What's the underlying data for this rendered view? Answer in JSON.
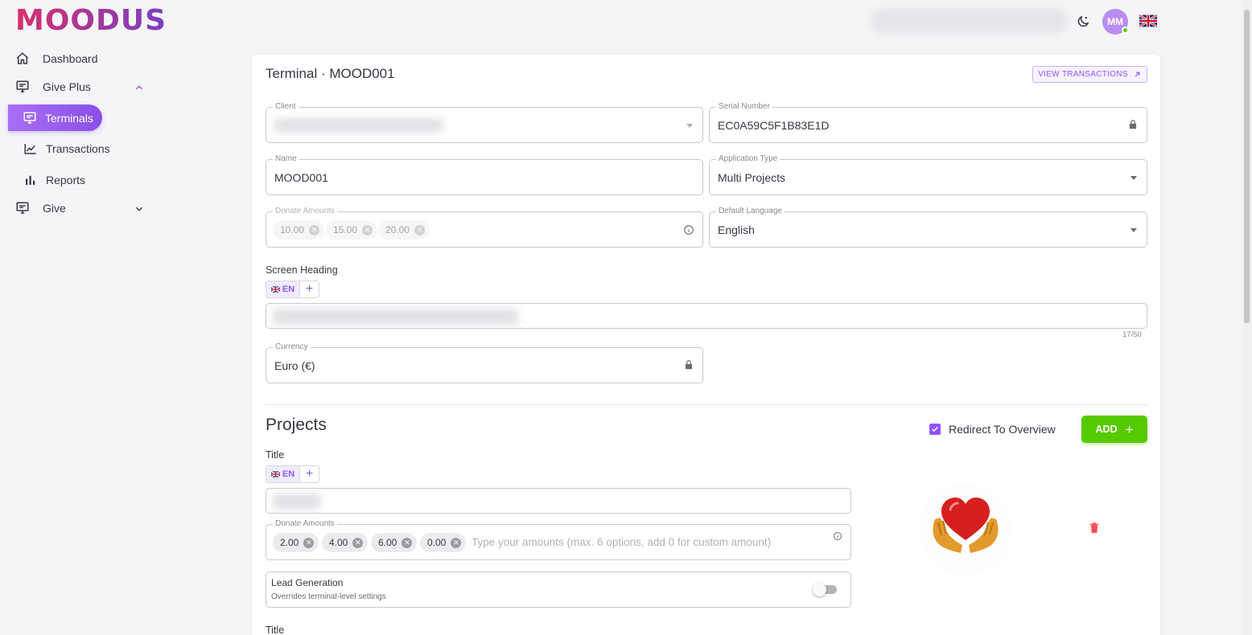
{
  "brand": {
    "logo_text": "MOODUS",
    "gradient_start": "#d8316a",
    "gradient_end": "#7b3fc4"
  },
  "topbar": {
    "theme_icon": "moon-icon",
    "avatar_initials": "MM",
    "language_flag": "uk-flag-icon"
  },
  "sidebar": {
    "items": [
      {
        "label": "Dashboard",
        "icon": "home-icon"
      },
      {
        "label": "Give Plus",
        "icon": "terminal-icon",
        "expanded": true
      },
      {
        "label": "Terminals",
        "icon": "terminal-icon",
        "active": true
      },
      {
        "label": "Transactions",
        "icon": "chart-line-icon"
      },
      {
        "label": "Reports",
        "icon": "bar-chart-icon"
      },
      {
        "label": "Give",
        "icon": "terminal-icon",
        "expanded": false
      }
    ]
  },
  "page": {
    "title": "Terminal · MOOD001",
    "view_transactions": "VIEW TRANSACTIONS"
  },
  "form": {
    "client": {
      "label": "Client"
    },
    "serial_number": {
      "label": "Serial Number",
      "value": "EC0A59C5F1B83E1D",
      "locked": true
    },
    "name": {
      "label": "Name",
      "value": "MOOD001"
    },
    "application_type": {
      "label": "Application Type",
      "value": "Multi Projects"
    },
    "donate_amounts": {
      "label": "Donate Amounts",
      "chips": [
        "10.00",
        "15.00",
        "20.00"
      ]
    },
    "default_language": {
      "label": "Default Language",
      "value": "English"
    },
    "screen_heading": {
      "label": "Screen Heading",
      "lang": "EN",
      "counter": "17/50"
    },
    "currency": {
      "label": "Currency",
      "value": "Euro (€)",
      "locked": true
    }
  },
  "projects": {
    "title": "Projects",
    "redirect_label": "Redirect To Overview",
    "redirect_checked": true,
    "add_label": "ADD",
    "items": [
      {
        "title_label": "Title",
        "lang": "EN",
        "donate_label": "Donate Amounts",
        "chips": [
          "2.00",
          "4.00",
          "6.00",
          "0.00"
        ],
        "donate_placeholder": "Type your amounts (max. 6 options, add 0 for custom amount)",
        "lead_generation": {
          "label": "Lead Generation",
          "help": "Overrides terminal-level settings",
          "enabled": false
        }
      }
    ],
    "next_title_label": "Title"
  },
  "colors": {
    "primary": "#9155fd",
    "success": "#56ca00",
    "danger": "#ff4c51"
  }
}
